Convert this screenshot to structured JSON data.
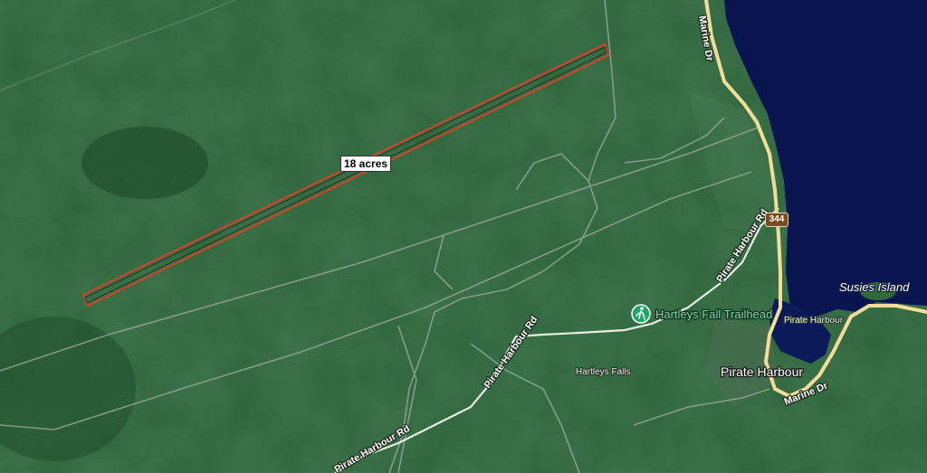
{
  "parcel": {
    "label": "18 acres",
    "outline_color": "#d8402a"
  },
  "roads": {
    "marine_dr_north": "Marine Dr",
    "marine_dr_south": "Marine Dr",
    "pirate_harbour_rd_1": "Pirate Harbour Rd",
    "pirate_harbour_rd_2": "Pirate Harbour Rd",
    "pirate_harbour_rd_3": "Pirate Harbour Rd",
    "route_shield": "344"
  },
  "places": {
    "pirate_harbour_town": "Pirate Harbour",
    "pirate_harbour_water": "Pirate Harbour",
    "hartleys_falls": "Hartleys Falls",
    "susies_island": "Susies Island"
  },
  "poi": {
    "trailhead": "Hartleys Fall Trailhead",
    "trailhead_icon": "hiker-icon"
  },
  "colors": {
    "forest": "#24582f",
    "water": "#0a1550",
    "road": "#f1dc9a",
    "track": "#9aa89c",
    "poi_green": "#1fa56a"
  }
}
